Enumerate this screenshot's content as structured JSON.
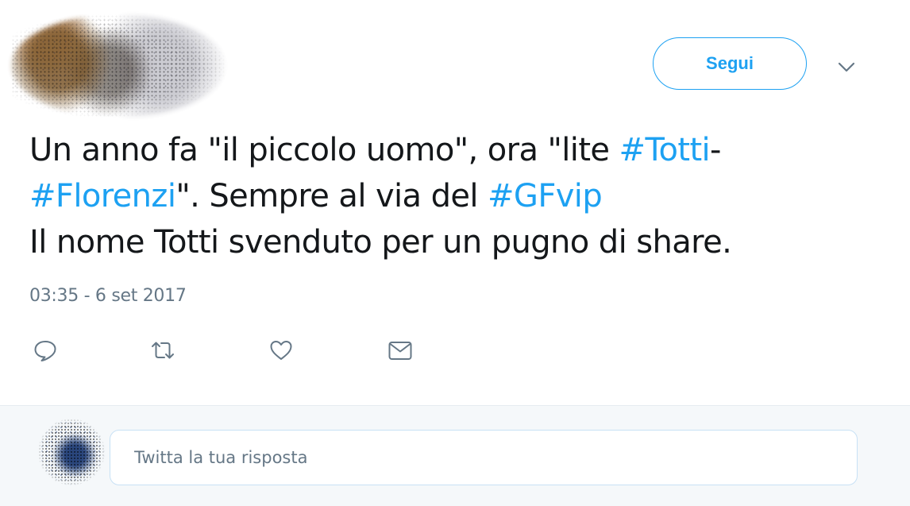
{
  "header": {
    "follow_label": "Segui",
    "author_avatar": "blurred-profile-photo",
    "more_icon": "chevron-down-icon"
  },
  "tweet": {
    "segments": [
      {
        "text": "Un anno fa \"il piccolo uomo\", ora \"lite ",
        "type": "text"
      },
      {
        "text": "#Totti",
        "type": "hashtag"
      },
      {
        "text": "-",
        "type": "text"
      },
      {
        "text": "#Florenzi",
        "type": "hashtag"
      },
      {
        "text": "\". Sempre al via del ",
        "type": "text"
      },
      {
        "text": "#GFvip",
        "type": "hashtag"
      },
      {
        "text": "Il nome Totti svenduto per un pugno di share.",
        "type": "text"
      }
    ],
    "timestamp": "03:35 - 6 set 2017"
  },
  "actions": [
    {
      "name": "reply",
      "icon": "speech-bubble-icon"
    },
    {
      "name": "retweet",
      "icon": "retweet-arrows-icon"
    },
    {
      "name": "like",
      "icon": "heart-icon"
    },
    {
      "name": "direct-message",
      "icon": "envelope-icon"
    }
  ],
  "reply_box": {
    "placeholder": "Twitta la tua risposta",
    "avatar": "blurred-profile-photo"
  },
  "colors": {
    "accent": "#1da1f2",
    "text": "#14171a",
    "muted": "#657786",
    "reply_background": "#f5f8fa"
  }
}
